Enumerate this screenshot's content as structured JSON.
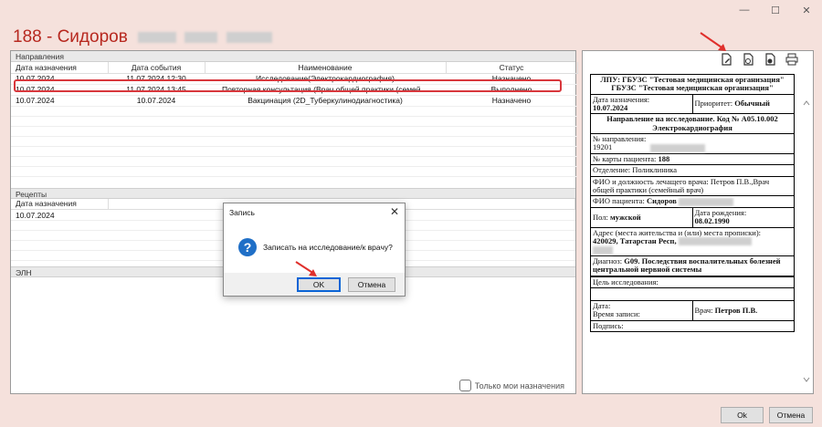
{
  "window": {
    "minimize": "—",
    "maximize": "☐",
    "close": "✕"
  },
  "title": "188 - Сидоров",
  "directions": {
    "section": "Направления",
    "columns": [
      "Дата назначения",
      "Дата события",
      "Наименование",
      "Статус"
    ],
    "rows": [
      {
        "date": "10.07.2024",
        "event": "11.07.2024 12:30",
        "name": "Исследование(Электрокардиография)",
        "status": "Назначено"
      },
      {
        "date": "10.07.2024",
        "event": "11.07.2024 13:45",
        "name": "Повторная консультация (Врач общей практики (семей…",
        "status": "Выполнено"
      },
      {
        "date": "10.07.2024",
        "event": "10.07.2024",
        "name": "Вакцинация (2D_Туберкулинодиагностика)",
        "status": "Назначено"
      }
    ]
  },
  "recipes": {
    "section": "Рецепты",
    "column": "Дата назначения",
    "rows": [
      "10.07.2024"
    ]
  },
  "eln": {
    "section": "ЭЛН"
  },
  "only_mine": "Только мои назначения",
  "doc": {
    "org": "ЛПУ: ГБУЗС \"Тестовая медицинская организация\" ГБУЗС \"Тестовая медицинская организация\"",
    "date_label": "Дата назначения:",
    "date_value": "10.07.2024",
    "priority_label": "Приоритет:",
    "priority_value": "Обычный",
    "header": "Направление на исследование. Код № А05.10.002 Электрокардиография",
    "num_label": "№ направления:",
    "num_value": "19201",
    "card_label": "№ карты пациента:",
    "card_value": "188",
    "dept": "Отделение: Поликлиника",
    "doctor_full": "ФИО и должность лечащего врача: Петров П.В.,Врач общей практики (семейный врач)",
    "patient_label": "ФИО пациента:",
    "patient_value": "Сидоров",
    "sex_label": "Пол:",
    "sex_value": "мужской",
    "birth_label": "Дата рождения:",
    "birth_value": "08.02.1990",
    "addr_label": "Адрес (места жительства и (или) места прописки):",
    "addr_value": "420029, Татарстан Респ,",
    "diag_label": "Диагноз:",
    "diag_value": "G09. Последствия воспалительных болезней центральной нервной системы",
    "goal": "Цель исследования:",
    "date2": "Дата:",
    "time2": "Время записи:",
    "doctor_label": "Врач:",
    "doctor_value": "Петров П.В.",
    "sign": "Подпись:"
  },
  "dialog": {
    "title": "Запись",
    "message": "Записать на исследование/к врачу?",
    "ok": "OK",
    "cancel": "Отмена"
  },
  "footer": {
    "ok": "Ok",
    "cancel": "Отмена"
  }
}
